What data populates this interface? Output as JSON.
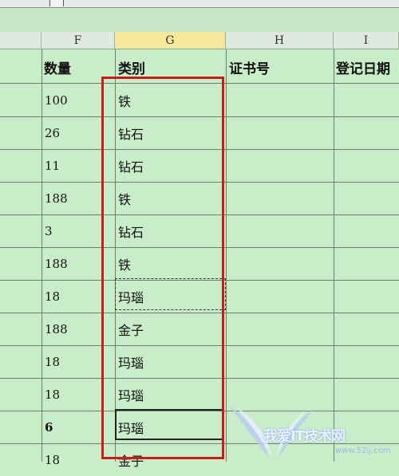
{
  "columns": [
    {
      "letter": "F",
      "header": "数量"
    },
    {
      "letter": "G",
      "header": "类别"
    },
    {
      "letter": "H",
      "header": "证书号"
    },
    {
      "letter": "I",
      "header": "登记日期"
    }
  ],
  "rows": [
    {
      "qty": "100",
      "category": "铁"
    },
    {
      "qty": "26",
      "category": "钻石"
    },
    {
      "qty": "11",
      "category": "钻石"
    },
    {
      "qty": "188",
      "category": "铁"
    },
    {
      "qty": "3",
      "category": "钻石"
    },
    {
      "qty": "188",
      "category": "铁"
    },
    {
      "qty": "18",
      "category": "玛瑙"
    },
    {
      "qty": "188",
      "category": "金子"
    },
    {
      "qty": "18",
      "category": "玛瑙"
    },
    {
      "qty": "18",
      "category": "玛瑙"
    },
    {
      "qty": "6",
      "category": "玛瑙"
    },
    {
      "qty": "18",
      "category": "金子"
    }
  ],
  "watermark": {
    "text": "我爱IT技术网",
    "url": "www.52ij.com"
  },
  "colors": {
    "highlight": "#cc1a1a",
    "cell_bg": "#c9ecc9",
    "selected_header": "#f6e89a"
  }
}
